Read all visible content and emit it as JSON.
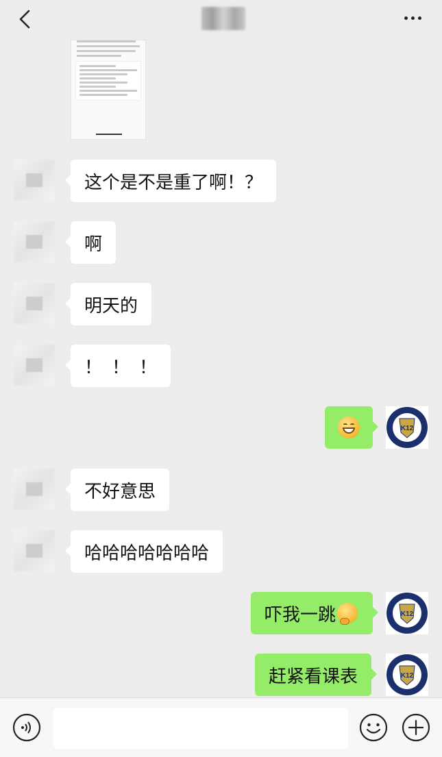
{
  "header": {
    "back_icon": "chevron-left-icon",
    "title": "",
    "more_icon": "more-dots-icon"
  },
  "messages": [
    {
      "side": "left",
      "text": "这个是不是重了啊！？"
    },
    {
      "side": "left",
      "text": "啊"
    },
    {
      "side": "left",
      "text": "明天的"
    },
    {
      "side": "left",
      "text": "！！！"
    },
    {
      "side": "right",
      "text": "",
      "emoji": "grin-emoji"
    },
    {
      "side": "left",
      "text": "不好意思"
    },
    {
      "side": "left",
      "text": "哈哈哈哈哈哈哈"
    },
    {
      "side": "right",
      "text": "吓我一跳",
      "emoji": "thinking-emoji"
    },
    {
      "side": "right",
      "text": "赶紧看课表"
    }
  ],
  "my_avatar": {
    "ring_text": "K-12 INTERNATIONAL ACADEMY",
    "center_text": "K12",
    "bottom_text": "SINCE 2002",
    "color": "#1a2f6b"
  },
  "input_bar": {
    "voice_icon": "voice-icon",
    "placeholder": "",
    "emoji_icon": "emoji-icon",
    "plus_icon": "plus-icon"
  },
  "colors": {
    "background": "#ededed",
    "my_bubble": "#95ec69",
    "their_bubble": "#ffffff"
  }
}
